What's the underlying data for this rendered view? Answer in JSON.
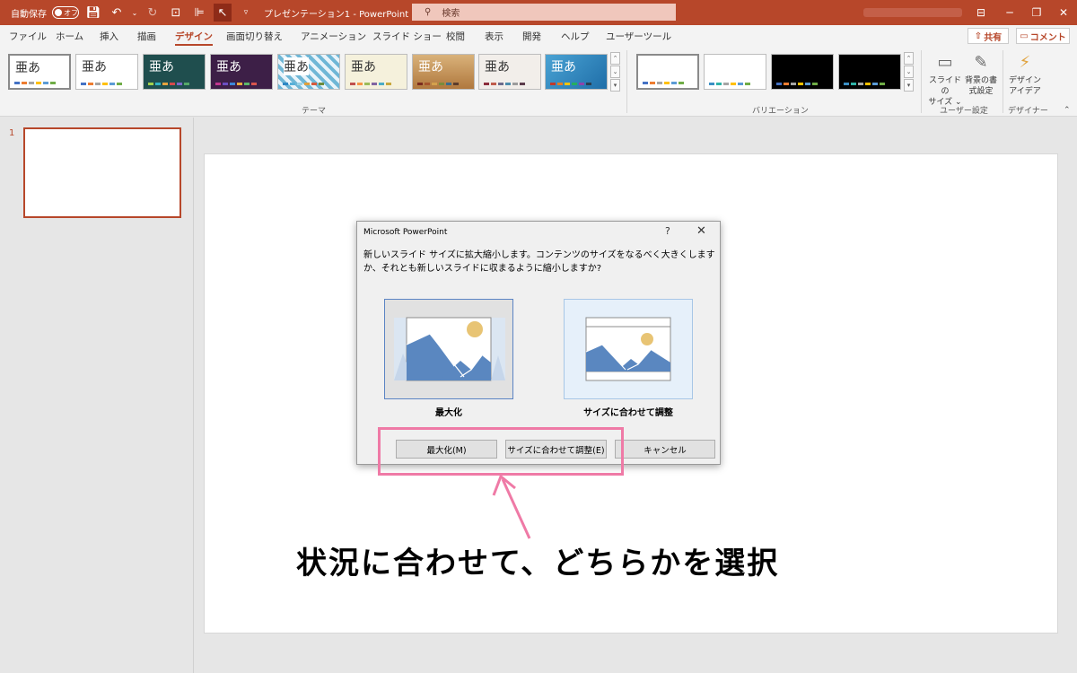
{
  "titlebar": {
    "autosave": "自動保存",
    "autosave_state": "オフ",
    "document_title": "プレゼンテーション1  -  PowerPoint",
    "search_placeholder": "検索"
  },
  "tabs": [
    "ファイル",
    "ホーム",
    "挿入",
    "描画",
    "デザイン",
    "画面切り替え",
    "アニメーション",
    "スライド ショー",
    "校閲",
    "表示",
    "開発",
    "ヘルプ",
    "ユーザーツール"
  ],
  "active_tab": "デザイン",
  "share_label": "共有",
  "comment_label": "コメント",
  "ribbon": {
    "theme_sample": "亜あ",
    "themes_group_label": "テーマ",
    "variants_group_label": "バリエーション",
    "slide_size_label_1": "スライドの",
    "slide_size_label_2": "サイズ ⌄",
    "background_label_1": "背景の書",
    "background_label_2": "式設定",
    "user_group_label": "ユーザー設定",
    "design_ideas_label_1": "デザイン",
    "design_ideas_label_2": "アイデア",
    "designer_group_label": "デザイナー"
  },
  "slides_pane": {
    "slide_number": "1"
  },
  "dialog": {
    "title": "Microsoft PowerPoint",
    "help": "?",
    "close": "✕",
    "message": "新しいスライド サイズに拡大縮小します。コンテンツのサイズをなるべく大きくしますか、それとも新しいスライドに収まるように縮小しますか?",
    "option_maximize": "最大化",
    "option_fit": "サイズに合わせて調整",
    "button_maximize": "最大化(M)",
    "button_fit": "サイズに合わせて調整(E)",
    "button_cancel": "キャンセル"
  },
  "annotation": {
    "text": "状況に合わせて、どちらかを選択",
    "color": "#ef7aa6"
  },
  "colors": {
    "accent": "#b7472a",
    "picture_blue": "#5a87c0",
    "sun": "#e8c474"
  }
}
